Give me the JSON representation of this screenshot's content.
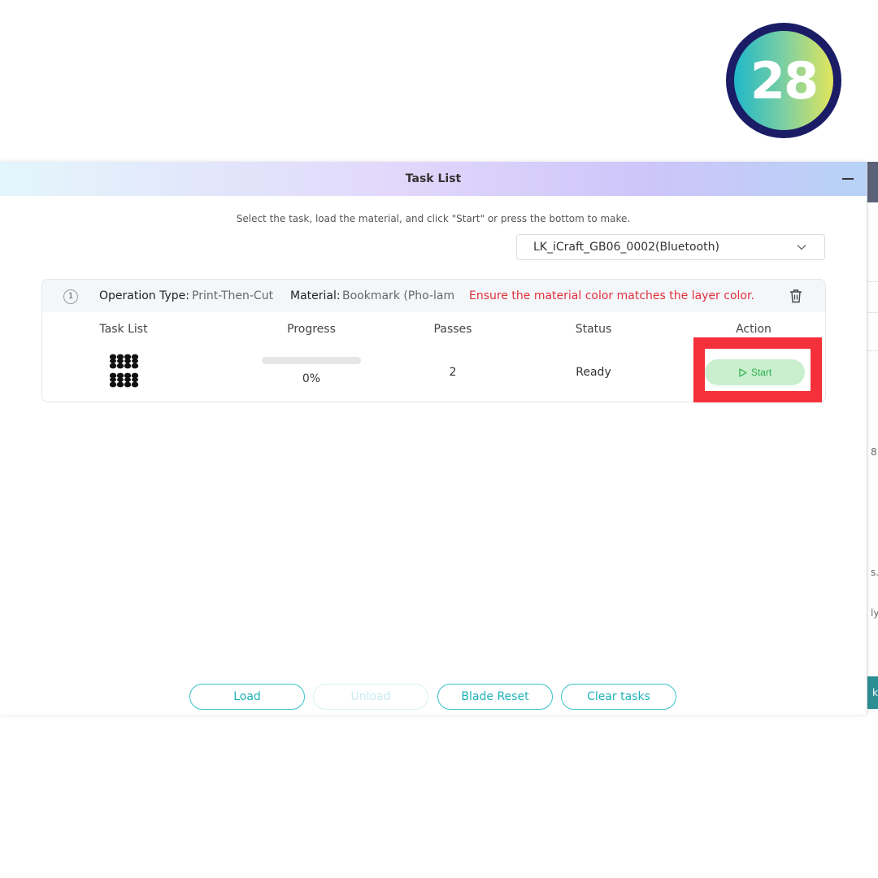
{
  "step_badge": {
    "number": "28"
  },
  "dialog": {
    "title": "Task List",
    "instruction": "Select the task, load the material, and click \"Start\" or press the bottom to make.",
    "device_select": {
      "value": "LK_iCraft_GB06_0002(Bluetooth)"
    }
  },
  "task": {
    "index": "1",
    "operation_type_label": "Operation Type:",
    "operation_type_value": "Print-Then-Cut",
    "material_label": "Material:",
    "material_value": "Bookmark (Pho-lam",
    "warning": "Ensure the material color matches the layer color.",
    "columns": {
      "task_list": "Task List",
      "progress": "Progress",
      "passes": "Passes",
      "status": "Status",
      "action": "Action"
    },
    "row": {
      "progress_fraction": 0,
      "progress_text": "0%",
      "passes": "2",
      "status": "Ready",
      "action_label": "Start"
    }
  },
  "bottom_buttons": {
    "load": "Load",
    "unload": "Unload",
    "blade_reset": "Blade Reset",
    "clear_tasks": "Clear tasks"
  },
  "background_app": {
    "text_1": "8.",
    "text_2": "s.",
    "text_3": "ly",
    "button_text": "k"
  },
  "colors": {
    "accent": "#37c2c7",
    "start_button_bg": "#c9efcf",
    "start_button_text": "#2cae49",
    "warning": "#e0313b",
    "highlight": "#f4303a",
    "badge_border": "#1a1d66"
  },
  "icons": {
    "minimize": "minimize-icon",
    "chevron": "chevron-down-icon",
    "trash": "trash-icon",
    "play": "play-icon"
  }
}
